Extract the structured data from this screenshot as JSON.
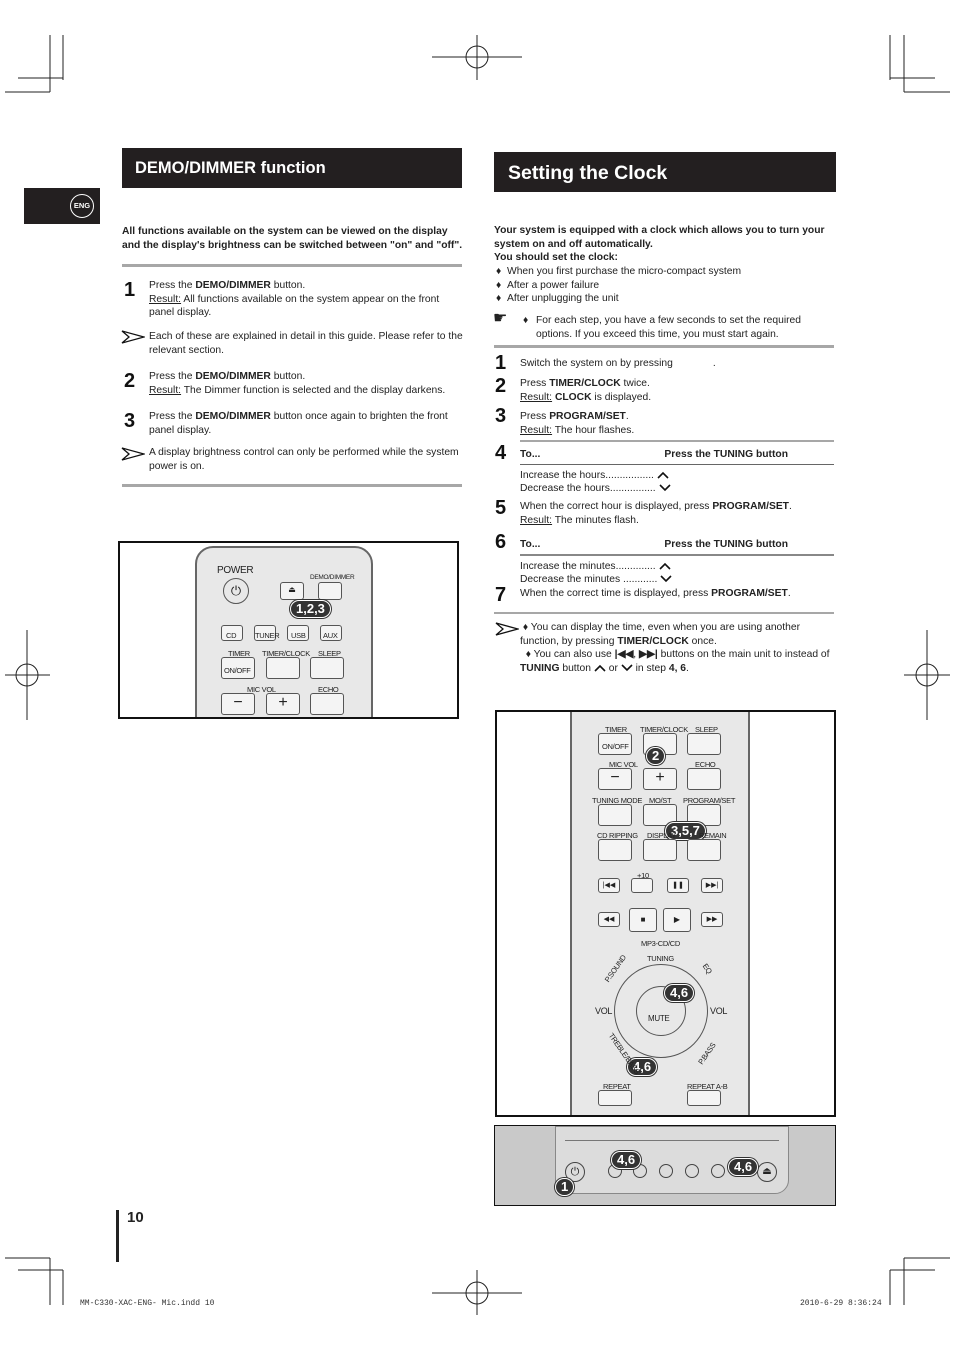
{
  "lang_tab": "ENG",
  "left": {
    "title": "DEMO/DIMMER function",
    "intro": "All functions available on the system can be viewed on the display and the display's  brightness can be switched between \"on\" and \"off\".",
    "steps": [
      {
        "n": "1",
        "pre": "Press the ",
        "bold": "DEMO/DIMMER",
        "post": " button.",
        "result_label": "Result:",
        "result": " All functions available on the system appear on the front panel display."
      },
      {
        "n": "2",
        "pre": "Press the ",
        "bold": "DEMO/DIMMER",
        "post": " button.",
        "result_label": "Result:",
        "result": " The Dimmer function is selected and the display darkens."
      },
      {
        "n": "3",
        "pre": "Press the ",
        "bold": "DEMO/DIMMER",
        "post": " button once again to brighten the front panel display."
      }
    ],
    "notes": [
      "Each of these are explained in detail in this guide. Please refer to the relevant section.",
      "A display brightness control can only be performed while the system power is on."
    ],
    "remote": {
      "labels": [
        "POWER",
        "DEMO/DIMMER",
        "CD",
        "TUNER",
        "USB",
        "AUX",
        "TIMER",
        "TIMER/CLOCK",
        "SLEEP",
        "ON/OFF",
        "MIC VOL",
        "ECHO"
      ],
      "badge": "1,2,3"
    }
  },
  "right": {
    "title": "Setting the Clock",
    "intro1": "Your system is equipped with a clock which allows you to turn your system on and off automatically.",
    "intro2": "You should set the clock:",
    "bullets": [
      "When you first purchase the micro-compact system",
      "After a power failure",
      "After unplugging the unit"
    ],
    "tip": "For each step, you have a few seconds to set the required options. If you exceed this time, you must start again.",
    "steps": {
      "s1": "Switch the system on by pressing",
      "s1_end": ".",
      "s2_pre": "Press ",
      "s2_bold": "TIMER/CLOCK",
      "s2_post": " twice.",
      "s2_res_label": "Result:",
      "s2_res_bold": "CLOCK",
      "s2_res": " is displayed.",
      "s3_pre": "Press ",
      "s3_bold": "PROGRAM/SET",
      "s3_post": ".",
      "s3_res_label": "Result:",
      "s3_res": " The hour flashes.",
      "s5_pre": "When the correct hour is displayed, press ",
      "s5_bold": "PROGRAM/SET",
      "s5_post": ".",
      "s5_res_label": "Result:",
      "s5_res": " The minutes flash.",
      "s7_pre": "When the correct time is displayed, press ",
      "s7_bold": "PROGRAM/SET",
      "s7_post": "."
    },
    "table_hours": {
      "col1": "To...",
      "col2": "Press the TUNING button",
      "rows": [
        "Increase the hours.................",
        "Decrease the hours................"
      ]
    },
    "table_minutes": {
      "col1": "To...",
      "col2": "Press the TUNING button",
      "rows": [
        "Increase the minutes..............",
        "Decrease the minutes ............"
      ]
    },
    "note1_pre": "You can display the time, even when you are using another function, by pressing ",
    "note1_bold": "TIMER/CLOCK",
    "note1_post": " once.",
    "note2_pre": "You can also use ",
    "note2_mid": " buttons on the main unit to instead of ",
    "note2_bold": "TUNING",
    "note2_post": " button",
    "note2_or": "or",
    "note2_step": "in step ",
    "note2_steps": "4, 6",
    "remote": {
      "labels": [
        "TIMER",
        "TIMER/CLOCK",
        "SLEEP",
        "ON/OFF",
        "MIC VOL",
        "ECHO",
        "TUNING MODE",
        "MO/ST",
        "PROGRAM/SET",
        "CD RIPPING",
        "DISPLAY",
        "REMAIN",
        "+10",
        "MP3-CD/CD",
        "TUNING",
        "P.SOUND",
        "EQ",
        "VOL",
        "MUTE",
        "TREBLE/BASS",
        "P.BASS",
        "REPEAT",
        "REPEAT A-B"
      ],
      "badges": [
        "2",
        "3,5,7",
        "4,6",
        "4,6"
      ]
    },
    "panel": {
      "badges": [
        "1",
        "4,6",
        "4,6"
      ]
    }
  },
  "page_number": "10",
  "footer": {
    "file": "MM-C330-XAC-ENG- Mic.indd   10",
    "date": "2010-6-29   8:36:24"
  }
}
